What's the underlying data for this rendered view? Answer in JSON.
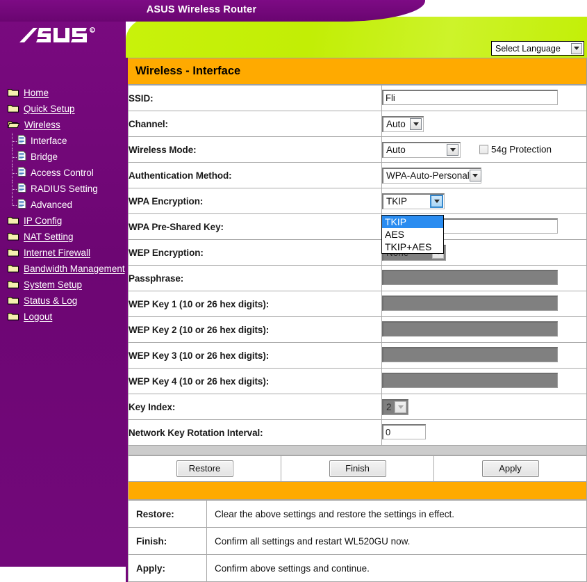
{
  "window": {
    "banner_title": "ASUS Wireless Router",
    "brand": "ASUS"
  },
  "language": {
    "label": "Select Language",
    "icon": "chevron-down-icon"
  },
  "page": {
    "title": "Wireless - Interface"
  },
  "sidebar": {
    "items": [
      {
        "label": "Home",
        "icon": "folder-icon",
        "level": 0,
        "state": "closed"
      },
      {
        "label": "Quick Setup",
        "icon": "folder-icon",
        "level": 0,
        "state": "closed"
      },
      {
        "label": "Wireless",
        "icon": "folder-open-icon",
        "level": 0,
        "state": "open"
      },
      {
        "label": "Interface",
        "icon": "document-icon",
        "level": 1,
        "state": "active"
      },
      {
        "label": "Bridge",
        "icon": "document-icon",
        "level": 1,
        "state": ""
      },
      {
        "label": "Access Control",
        "icon": "document-icon",
        "level": 1,
        "state": ""
      },
      {
        "label": "RADIUS Setting",
        "icon": "document-icon",
        "level": 1,
        "state": ""
      },
      {
        "label": "Advanced",
        "icon": "document-icon",
        "level": 1,
        "state": "last"
      },
      {
        "label": "IP Config",
        "icon": "folder-icon",
        "level": 0,
        "state": "closed"
      },
      {
        "label": "NAT Setting",
        "icon": "folder-icon",
        "level": 0,
        "state": "closed"
      },
      {
        "label": "Internet Firewall",
        "icon": "folder-icon",
        "level": 0,
        "state": "closed"
      },
      {
        "label": "Bandwidth Management",
        "icon": "folder-icon",
        "level": 0,
        "state": "closed"
      },
      {
        "label": "System Setup",
        "icon": "folder-icon",
        "level": 0,
        "state": "closed"
      },
      {
        "label": "Status & Log",
        "icon": "folder-icon",
        "level": 0,
        "state": "closed"
      },
      {
        "label": "Logout",
        "icon": "folder-icon",
        "level": 0,
        "state": "closed"
      }
    ]
  },
  "form": {
    "ssid": {
      "label": "SSID:",
      "value": "Fli"
    },
    "channel": {
      "label": "Channel:",
      "value": "Auto"
    },
    "wireless_mode": {
      "label": "Wireless Mode:",
      "value": "Auto"
    },
    "protection": {
      "label": "54g Protection",
      "checked": false
    },
    "auth_method": {
      "label": "Authentication Method:",
      "value": "WPA-Auto-Personal"
    },
    "wpa_encryption": {
      "label": "WPA Encryption:",
      "value": "TKIP",
      "expanded": true,
      "options": [
        "TKIP",
        "AES",
        "TKIP+AES"
      ],
      "selected_option": "TKIP"
    },
    "wpa_psk": {
      "label": "WPA Pre-Shared Key:",
      "value": ""
    },
    "wep_encryption": {
      "label": "WEP Encryption:",
      "value": "None",
      "disabled": true
    },
    "passphrase": {
      "label": "Passphrase:",
      "value": "",
      "disabled": true
    },
    "wep_key_1": {
      "label": "WEP Key 1 (10 or 26 hex digits):",
      "value": "",
      "disabled": true
    },
    "wep_key_2": {
      "label": "WEP Key 2 (10 or 26 hex digits):",
      "value": "",
      "disabled": true
    },
    "wep_key_3": {
      "label": "WEP Key 3 (10 or 26 hex digits):",
      "value": "",
      "disabled": true
    },
    "wep_key_4": {
      "label": "WEP Key 4 (10 or 26 hex digits):",
      "value": "",
      "disabled": true
    },
    "key_index": {
      "label": "Key Index:",
      "value": "2",
      "disabled": true
    },
    "key_rotation": {
      "label": "Network Key Rotation Interval:",
      "value": "0"
    }
  },
  "buttons": {
    "restore": "Restore",
    "finish": "Finish",
    "apply": "Apply"
  },
  "help": {
    "rows": [
      {
        "key": "Restore:",
        "text": "Clear the above settings and restore the settings in effect."
      },
      {
        "key": "Finish:",
        "text": "Confirm all settings and restart WL520GU now."
      },
      {
        "key": "Apply:",
        "text": "Confirm above settings and continue."
      }
    ]
  },
  "colors": {
    "purple": "#74077a",
    "green": "#c3ef07",
    "orange": "#ffaa00",
    "highlight_blue": "#2a8cf0",
    "disabled_gray": "#808080"
  }
}
